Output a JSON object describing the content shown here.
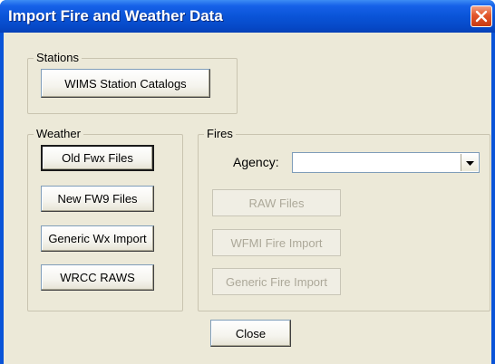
{
  "window": {
    "title": "Import Fire and Weather Data"
  },
  "stations": {
    "label": "Stations",
    "wims_button": "WIMS Station Catalogs"
  },
  "weather": {
    "label": "Weather",
    "buttons": [
      "Old Fwx Files",
      "New FW9 Files",
      "Generic Wx Import",
      "WRCC RAWS"
    ]
  },
  "fires": {
    "label": "Fires",
    "agency_label": "Agency:",
    "agency_value": "",
    "buttons": [
      "RAW Files",
      "WFMI Fire Import",
      "Generic Fire Import"
    ]
  },
  "footer": {
    "close_button": "Close"
  },
  "colors": {
    "titlebar": "#0a54d8",
    "client_bg": "#ece9d8",
    "close_button": "#e2562b",
    "disabled_text": "#aca899"
  },
  "icons": {
    "close": "close-icon",
    "dropdown": "chevron-down-icon"
  }
}
